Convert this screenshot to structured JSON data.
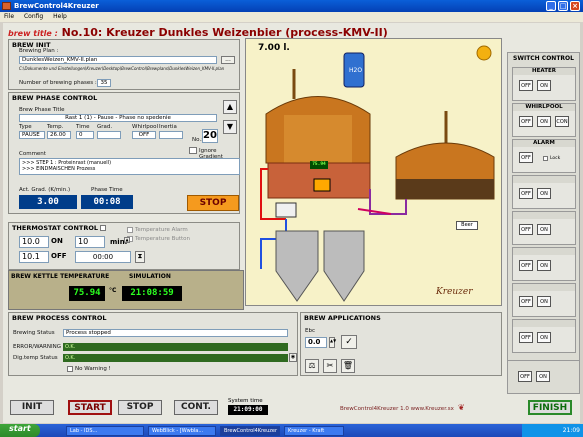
{
  "window": {
    "title": "BrewControl4Kreuzer",
    "menu": [
      "File",
      "Config",
      "Help"
    ]
  },
  "brew_title": {
    "label": "brew title :",
    "text": "No.10: Kreuzer Dunkles Weizenbier (process-KMV-II)"
  },
  "brew_init": {
    "heading": "BREW INIT",
    "plan_label": "Brewing Plan :",
    "plan_value": "DunklesWeizen_KMV-II.plan",
    "path_value": "C:\\Dokumente und Einstellungen\\Kreuzer\\Desktop\\BrewControl\\Brewplans\\DunklesWeizen_KMV-II.plan",
    "browse_label": "...",
    "phases_label": "Number of brewing phases :",
    "phases_value": "35"
  },
  "brew_phase": {
    "heading": "BREW PHASE CONTROL",
    "phase_title_label": "Brew Phase Title",
    "phase_title_value": "Rast 1 (1) - Pause - Phase no spedenie",
    "cols": [
      "Type",
      "Temp.",
      "Time",
      "Grad.",
      "Whirlpool",
      "Inertia"
    ],
    "type_value": "PAUSE",
    "temp_value": "26.00",
    "time_value": "0",
    "grad_value": "",
    "whirlpool_value": "OFF",
    "no_label": "No.:",
    "no_value": "20",
    "ignore_gradient_label": "Ignore Gradient",
    "comment_label": "Comment",
    "comment_lines": [
      ">>> STEP 1 : Proteinrast (manuell)",
      ">>> EINDMAISCHEN Prozess"
    ],
    "act_grad_label": "Act. Grad. (K/min.)",
    "phase_time_label": "Phase Time",
    "act_grad_value": "3.00",
    "phase_time_value": "00:08",
    "stop_label": "STOP"
  },
  "thermostat": {
    "heading": "THERMOSTAT CONTROL",
    "on_temp": "10.0",
    "off_temp": "10.1",
    "on_label": "ON",
    "off_label": "OFF",
    "min_value": "10",
    "min_label": "min.",
    "timer_value": "00:00",
    "temp_alarm_label": "Temperature Alarm",
    "temp_button_label": "Temperature Button"
  },
  "kettle": {
    "heading": "BREW KETTLE TEMPERATURE",
    "sim_label": "SIMULATION",
    "temp_value": "75.94",
    "unit": "°C",
    "clock_value": "21:08:59"
  },
  "scene": {
    "volume": "7.00 l.",
    "gauge": "75.94",
    "brand": "Kreuzer",
    "h2o_label": "H2O",
    "bottle_label": "Beer"
  },
  "switch": {
    "heading": "SWITCH CONTROL",
    "groups": [
      {
        "title": "HEATER",
        "btns": [
          "OFF",
          "ON"
        ]
      },
      {
        "title": "WHIRLPOOL",
        "btns": [
          "OFF",
          "ON",
          "CON"
        ]
      },
      {
        "title": "ALARM",
        "btns": [
          "OFF"
        ],
        "extra": "Lock"
      },
      {
        "title": "",
        "btns": [
          "OFF",
          "ON"
        ]
      },
      {
        "title": "",
        "btns": [
          "OFF",
          "ON"
        ]
      },
      {
        "title": "",
        "btns": [
          "OFF",
          "ON"
        ]
      },
      {
        "title": "",
        "btns": [
          "OFF",
          "ON"
        ]
      },
      {
        "title": "",
        "btns": [
          "OFF",
          "ON"
        ]
      },
      {
        "title": "",
        "btns": [
          "OFF",
          "ON"
        ]
      }
    ]
  },
  "process": {
    "heading": "BREW PROCESS CONTROL",
    "status_label": "Brewing Status",
    "status_value": "Process stopped",
    "error_label": "ERROR/WARNING",
    "error_value": "O.K.",
    "dig_label": "Dig.temp Status",
    "dig_value": "O.K.",
    "nowarning_label": "No Warning !"
  },
  "apps": {
    "heading": "BREW APPLICATIONS",
    "ebc_label": "Ebc",
    "value": "0.0"
  },
  "bottom": {
    "init": "INIT",
    "start": "START",
    "stop": "STOP",
    "cont": "CONT.",
    "systime_label": "System time",
    "systime_value": "21:09:00",
    "version": "BrewControl4Kreuzer 1.0     www.Kreuzer.sx",
    "finish": "FINISH"
  },
  "taskbar": {
    "start": "start",
    "tasks": [
      "Lab - IDS...",
      "WebBlick - [Wwbla...",
      "BrewControl4Kreuzer",
      "Kreuzer - Kraft"
    ],
    "clock": "21:09"
  }
}
